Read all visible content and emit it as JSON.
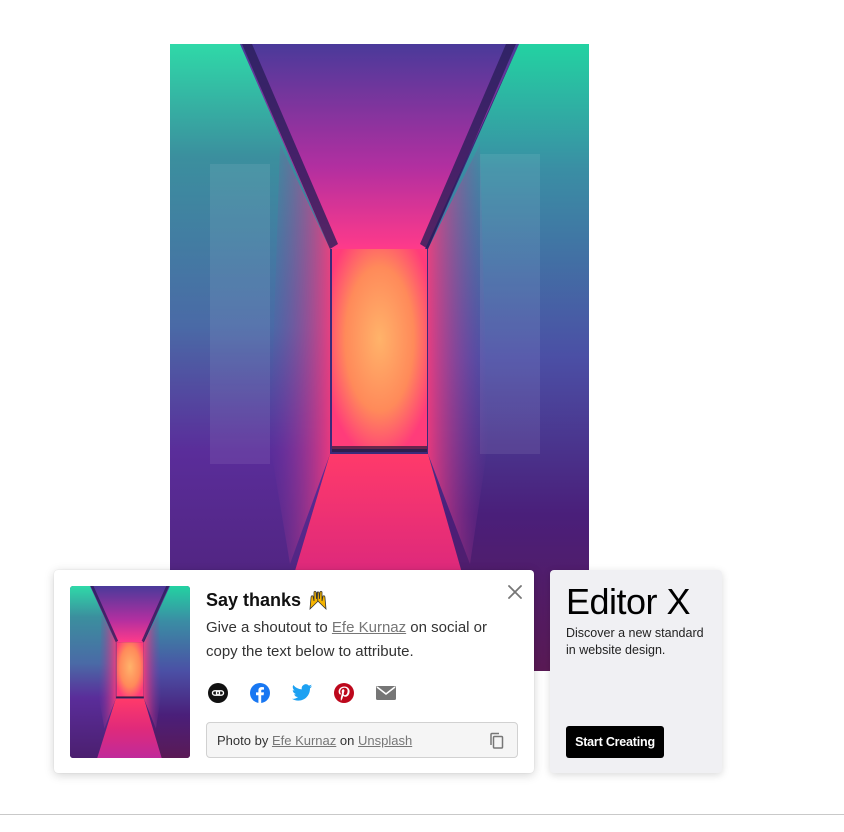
{
  "hero_photo": {
    "alt": ""
  },
  "thanks_card": {
    "title": "Say thanks",
    "body_prefix": "Give a shoutout to ",
    "photographer": "Efe Kurnaz",
    "body_suffix": " on social or copy the text below to attribute.",
    "share_icons": [
      "link-icon",
      "facebook-icon",
      "twitter-icon",
      "pinterest-icon",
      "email-icon"
    ],
    "attribution": {
      "prefix": "Photo by ",
      "photographer": "Efe Kurnaz",
      "middle": " on ",
      "source": "Unsplash"
    }
  },
  "ad": {
    "logo": "Editor X",
    "text": "Discover a new standard in website design.",
    "cta": "Start Creating"
  },
  "colors": {
    "facebook": "#1877f2",
    "twitter": "#1da1f2",
    "pinterest": "#bd081c",
    "icon_gray": "#767676"
  }
}
